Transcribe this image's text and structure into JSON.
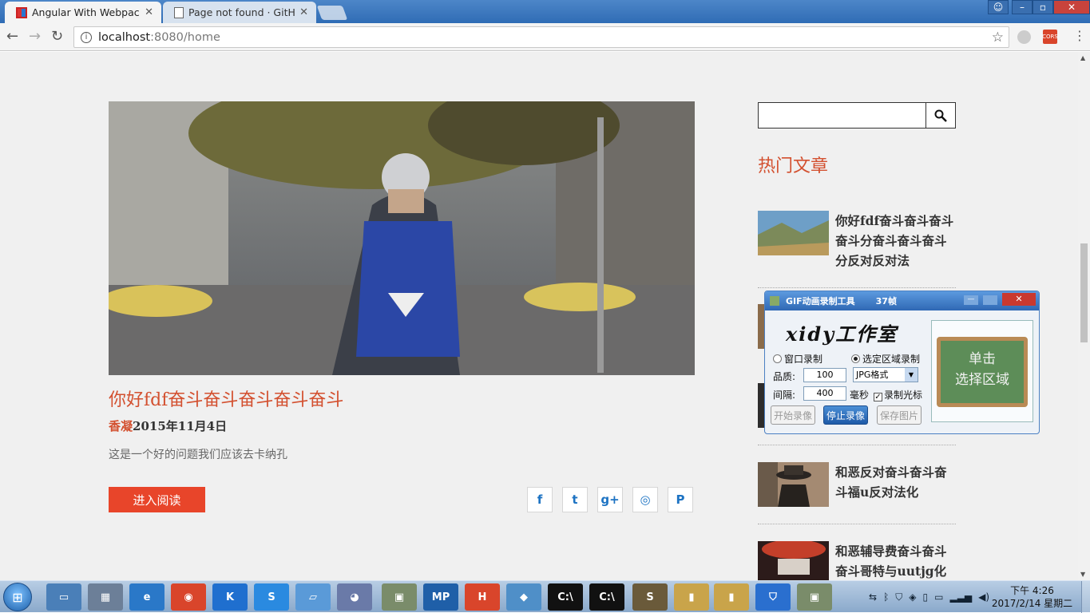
{
  "browser": {
    "tabs": [
      {
        "title": "Angular With Webpack",
        "favicon": "angular-icon",
        "active": true
      },
      {
        "title": "Page not found · GitHub",
        "favicon": "document-icon",
        "active": false
      }
    ],
    "address": {
      "host": "localhost",
      "path": ":8080/home"
    },
    "window_controls": {
      "minimize": "–",
      "maximize": "▫",
      "close": "✕"
    },
    "ext_cors_label": "CORS"
  },
  "post": {
    "title": "你好fdf奋斗奋斗奋斗奋斗奋斗",
    "author": "香凝",
    "date": "2015年11月4日",
    "excerpt": "这是一个好的问题我们应该去卡纳孔",
    "read_more": "进入阅读",
    "social": [
      {
        "glyph": "f",
        "name": "facebook-icon"
      },
      {
        "glyph": "t",
        "name": "twitter-icon"
      },
      {
        "glyph": "g+",
        "name": "google-plus-icon"
      },
      {
        "glyph": "◎",
        "name": "dribbble-icon"
      },
      {
        "glyph": "P",
        "name": "pinterest-icon"
      }
    ]
  },
  "sidebar": {
    "search_placeholder": "",
    "popular_title": "热门文章",
    "items": [
      {
        "text": "你好fdf奋斗奋斗奋斗奋斗分奋斗奋斗奋斗分反对反对法"
      },
      {
        "text": ""
      },
      {
        "text": ""
      },
      {
        "text": "和恶反对奋斗奋斗奋斗福u反对法化"
      },
      {
        "text": "和恶辅导费奋斗奋斗奋斗哥特与uutjg化"
      }
    ]
  },
  "gif_tool": {
    "title": "GIF动画录制工具",
    "frames": "37帧",
    "brand": "xidy工作室",
    "window_record": "窗口录制",
    "region_record": "选定区域录制",
    "quality_label": "品质:",
    "quality_value": "100",
    "format": "JPG格式",
    "interval_label": "间隔:",
    "interval_value": "400",
    "interval_unit": "毫秒",
    "record_cursor": "录制光标",
    "btn_start": "开始录像",
    "btn_stop": "停止录像",
    "btn_save": "保存图片",
    "board_line1": "单击",
    "board_line2": "选择区域"
  },
  "taskbar": {
    "clock_time": "下午 4:26",
    "clock_date": "2017/2/14 星期二"
  }
}
